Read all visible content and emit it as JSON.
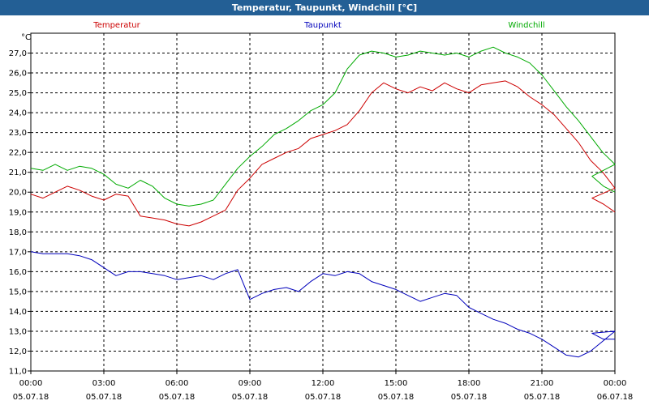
{
  "window": {
    "title": "Temperatur, Taupunkt, Windchill [°C]"
  },
  "colors": {
    "titlebar": "#235f95",
    "grid": "#000000"
  },
  "chart_data": {
    "type": "line",
    "title": "Temperatur, Taupunkt, Windchill [°C]",
    "ylabel": "°C",
    "ylim": [
      11.0,
      28.0
    ],
    "xlim": [
      "2018-07-05 00:00",
      "2018-07-06 00:00"
    ],
    "grid": true,
    "legend": "top",
    "y_ticks": [
      "11,0",
      "12,0",
      "13,0",
      "14,0",
      "15,0",
      "16,0",
      "17,0",
      "18,0",
      "19,0",
      "20,0",
      "21,0",
      "22,0",
      "23,0",
      "24,0",
      "25,0",
      "26,0",
      "27,0"
    ],
    "x_ticks": [
      {
        "time": "00:00",
        "date": "05.07.18"
      },
      {
        "time": "03:00",
        "date": "05.07.18"
      },
      {
        "time": "06:00",
        "date": "05.07.18"
      },
      {
        "time": "09:00",
        "date": "05.07.18"
      },
      {
        "time": "12:00",
        "date": "05.07.18"
      },
      {
        "time": "15:00",
        "date": "05.07.18"
      },
      {
        "time": "18:00",
        "date": "05.07.18"
      },
      {
        "time": "21:00",
        "date": "05.07.18"
      },
      {
        "time": "00:00",
        "date": "06.07.18"
      }
    ],
    "x_hours": [
      0,
      0.5,
      1,
      1.5,
      2,
      2.5,
      3,
      3.5,
      4,
      4.5,
      5,
      5.5,
      6,
      6.5,
      7,
      7.5,
      8,
      8.5,
      9,
      9.5,
      10,
      10.5,
      11,
      11.5,
      12,
      12.5,
      13,
      13.5,
      14,
      14.5,
      15,
      15.5,
      16,
      16.5,
      17,
      17.5,
      18,
      18.5,
      19,
      19.5,
      20,
      20.5,
      21,
      21.5,
      22,
      22.5,
      23,
      23.5,
      24
    ],
    "series": [
      {
        "name": "Temperatur",
        "color": "#cc0000",
        "values": [
          19.9,
          19.7,
          20.0,
          20.3,
          20.1,
          19.8,
          19.6,
          19.9,
          19.8,
          18.8,
          18.7,
          18.6,
          18.4,
          18.3,
          18.5,
          18.8,
          19.1,
          20.1,
          20.7,
          21.4,
          21.7,
          22.0,
          22.2,
          22.7,
          22.9,
          23.1,
          23.4,
          24.1,
          25.0,
          25.5,
          25.2,
          25.0,
          25.3,
          25.1,
          25.5,
          25.2,
          25.0,
          25.4,
          25.5,
          25.6,
          25.3,
          24.8,
          24.4,
          23.9,
          23.2,
          22.5,
          21.6,
          21.0,
          20.2,
          19.7,
          19.4,
          19.0
        ]
      },
      {
        "name": "Taupunkt",
        "color": "#0000bb",
        "values": [
          17.0,
          16.9,
          16.9,
          16.9,
          16.8,
          16.6,
          16.2,
          15.8,
          16.0,
          16.0,
          15.9,
          15.8,
          15.6,
          15.7,
          15.8,
          15.6,
          15.9,
          16.1,
          14.6,
          14.9,
          15.1,
          15.2,
          15.0,
          15.5,
          15.9,
          15.8,
          16.0,
          15.9,
          15.5,
          15.3,
          15.1,
          14.8,
          14.5,
          14.7,
          14.9,
          14.8,
          14.2,
          13.9,
          13.6,
          13.4,
          13.1,
          12.9,
          12.6,
          12.2,
          11.8,
          11.7,
          12.0,
          12.5,
          13.0,
          12.9,
          12.6,
          12.6
        ]
      },
      {
        "name": "Windchill",
        "color": "#00aa00",
        "values": [
          21.2,
          21.1,
          21.4,
          21.1,
          21.3,
          21.2,
          20.9,
          20.4,
          20.2,
          20.6,
          20.3,
          19.7,
          19.4,
          19.3,
          19.4,
          19.6,
          20.4,
          21.2,
          21.8,
          22.3,
          22.9,
          23.2,
          23.6,
          24.1,
          24.4,
          25.0,
          26.2,
          26.9,
          27.1,
          27.0,
          26.8,
          26.9,
          27.1,
          27.0,
          26.9,
          27.0,
          26.8,
          27.1,
          27.3,
          27.0,
          26.8,
          26.5,
          25.9,
          25.1,
          24.3,
          23.6,
          22.8,
          22.0,
          21.4,
          20.8,
          20.3,
          20.0
        ]
      }
    ]
  }
}
